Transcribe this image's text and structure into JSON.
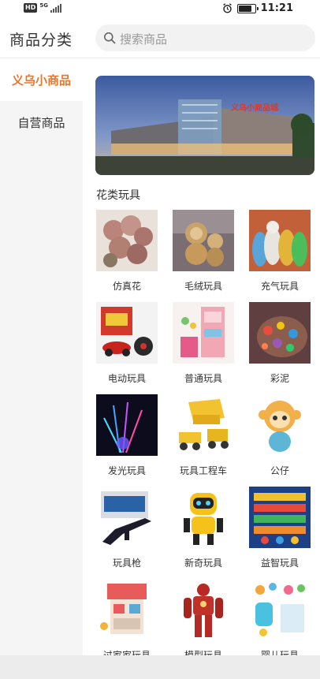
{
  "status_bar": {
    "hd_badge": "HD",
    "network": "5G",
    "time": "11:21",
    "icons": [
      "signal-icon",
      "alarm-icon",
      "battery-icon"
    ],
    "battery_level": 0.8
  },
  "header": {
    "title": "商品分类",
    "search_placeholder": "搜索商品"
  },
  "sidebar": {
    "items": [
      {
        "label": "义乌小商品",
        "active": true
      },
      {
        "label": "自营商品",
        "active": false
      }
    ]
  },
  "main": {
    "banner_text": "义乌小商品城",
    "section_title": "花类玩具",
    "products": [
      {
        "label": "仿真花"
      },
      {
        "label": "毛绒玩具"
      },
      {
        "label": "充气玩具"
      },
      {
        "label": "电动玩具"
      },
      {
        "label": "普通玩具"
      },
      {
        "label": "彩泥"
      },
      {
        "label": "发光玩具"
      },
      {
        "label": "玩具工程车"
      },
      {
        "label": "公仔"
      },
      {
        "label": "玩具枪"
      },
      {
        "label": "新奇玩具"
      },
      {
        "label": "益智玩具"
      },
      {
        "label": "过家家玩具"
      },
      {
        "label": "模型玩具"
      },
      {
        "label": "婴儿玩具"
      }
    ]
  },
  "colors": {
    "accent": "#e8772e",
    "sidebar_bg": "#f5f5f5",
    "search_bg": "#f2f2f2"
  }
}
